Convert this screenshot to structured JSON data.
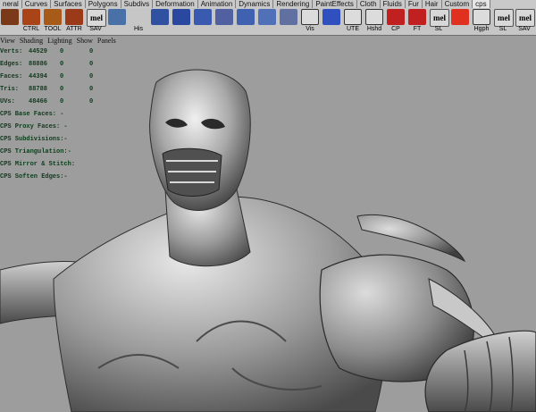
{
  "tabs": [
    "neral",
    "Curves",
    "Surfaces",
    "Polygons",
    "Subdivs",
    "Deformation",
    "Animation",
    "Dynamics",
    "Rendering",
    "PaintEffects",
    "Cloth",
    "Fluids",
    "Fur",
    "Hair",
    "Custom",
    "cps"
  ],
  "shelf": [
    {
      "label": "",
      "icon": "character-icon",
      "color": "#7a3a1a"
    },
    {
      "label": "CTRL",
      "icon": "ctrl-icon",
      "color": "#a84418"
    },
    {
      "label": "TOOL",
      "icon": "tool-icon",
      "color": "#a85a18"
    },
    {
      "label": "ATTR",
      "icon": "attr-icon",
      "color": "#9a3a18"
    },
    {
      "label": "SAV",
      "icon": "mel",
      "color": "#d8d8d8"
    },
    {
      "label": "",
      "icon": "grid-icon",
      "color": "#4a70a8"
    },
    {
      "label": "His",
      "icon": "history-icon",
      "color": "#c6c6c6"
    },
    {
      "label": "",
      "icon": "cube-icon",
      "color": "#3050a0"
    },
    {
      "label": "",
      "icon": "cube-icon",
      "color": "#2a48a0"
    },
    {
      "label": "",
      "icon": "cube-icon",
      "color": "#3a5ab0"
    },
    {
      "label": "",
      "icon": "split-icon",
      "color": "#5060a0"
    },
    {
      "label": "",
      "icon": "wedge-icon",
      "color": "#4060b0"
    },
    {
      "label": "",
      "icon": "merge-icon",
      "color": "#5070b8"
    },
    {
      "label": "",
      "icon": "extrude-icon",
      "color": "#6070a0"
    },
    {
      "label": "Vis",
      "icon": "box",
      "color": "#dcdcdc"
    },
    {
      "label": "",
      "icon": "pyramid-icon",
      "color": "#3050c0"
    },
    {
      "label": "UTE",
      "icon": "box",
      "color": "#dcdcdc"
    },
    {
      "label": "Hshd",
      "icon": "box",
      "color": "#dcdcdc"
    },
    {
      "label": "CP",
      "icon": "arrow-icon",
      "color": "#c02020"
    },
    {
      "label": "FT",
      "icon": "arrow-icon",
      "color": "#c02020"
    },
    {
      "label": "SL",
      "icon": "mel",
      "color": "#d8d8d8"
    },
    {
      "label": "",
      "icon": "target-icon",
      "color": "#e03020"
    },
    {
      "label": "Hgph",
      "icon": "box",
      "color": "#dcdcdc"
    },
    {
      "label": "SL",
      "icon": "mel",
      "color": "#d8d8d8"
    },
    {
      "label": "SAV",
      "icon": "mel",
      "color": "#d8d8d8"
    },
    {
      "label": "",
      "icon": "box",
      "color": "#dcdcdc"
    }
  ],
  "menubar": [
    "View",
    "Shading",
    "Lighting",
    "Show",
    "Panels"
  ],
  "hud": {
    "stats": [
      {
        "label": "Verts:",
        "a": "44529",
        "b": "0",
        "c": "0"
      },
      {
        "label": "Edges:",
        "a": "88886",
        "b": "0",
        "c": "0"
      },
      {
        "label": "Faces:",
        "a": "44394",
        "b": "0",
        "c": "0"
      },
      {
        "label": "Tris:",
        "a": "88788",
        "b": "0",
        "c": "0"
      },
      {
        "label": "UVs:",
        "a": "48466",
        "b": "0",
        "c": "0"
      }
    ],
    "cps": [
      "CPS Base Faces: -",
      "CPS Proxy Faces: -",
      "CPS Subdivisions:-",
      "CPS Triangulation:-",
      "CPS Mirror & Stitch:",
      "CPS Soften Edges:-"
    ]
  },
  "colors": {
    "viewport": "#9d9d9d",
    "hud_text": "#0a3d1a",
    "shelf": "#c6c6c6"
  }
}
